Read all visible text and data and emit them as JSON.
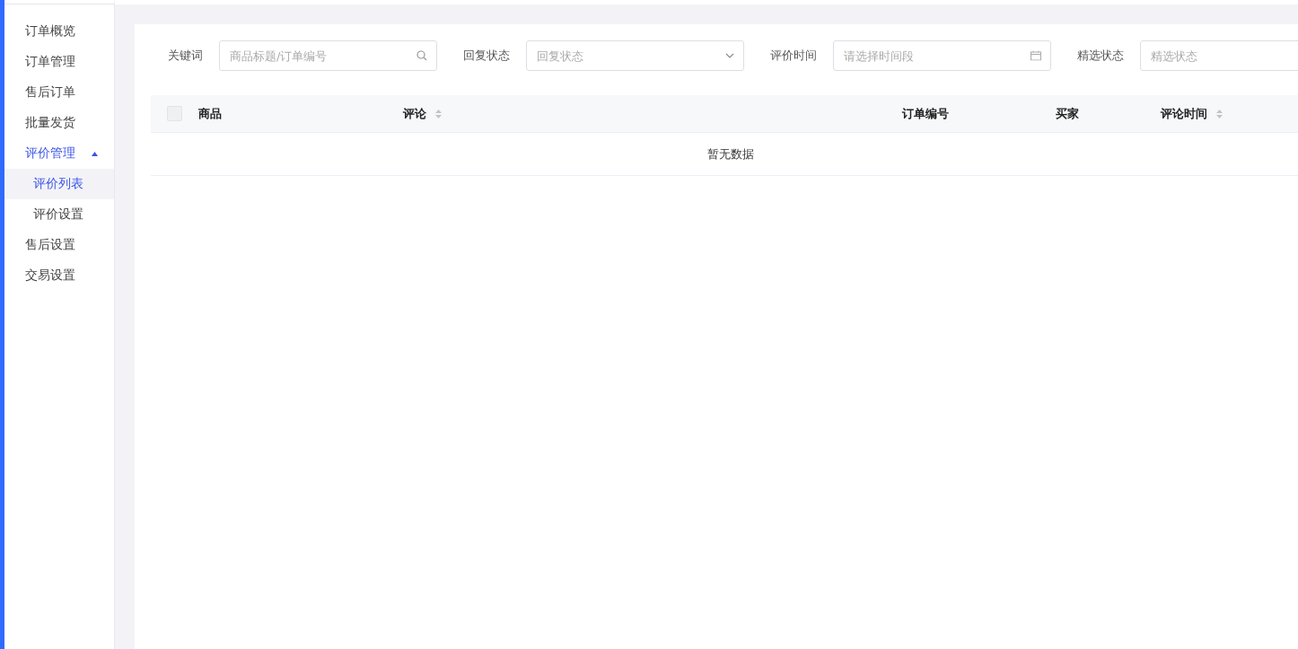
{
  "sidebar": {
    "items": [
      {
        "label": "订单概览",
        "selected": false
      },
      {
        "label": "订单管理",
        "selected": false
      },
      {
        "label": "售后订单",
        "selected": false
      },
      {
        "label": "批量发货",
        "selected": false
      },
      {
        "label": "评价管理",
        "selected": false,
        "expanded": true,
        "children": [
          {
            "label": "评价列表",
            "selected": true
          },
          {
            "label": "评价设置",
            "selected": false
          }
        ]
      },
      {
        "label": "售后设置",
        "selected": false
      },
      {
        "label": "交易设置",
        "selected": false
      }
    ]
  },
  "filters": [
    {
      "kind": "search",
      "label": "关键词",
      "placeholder": "商品标题/订单编号"
    },
    {
      "kind": "select",
      "label": "回复状态",
      "placeholder": "回复状态"
    },
    {
      "kind": "date",
      "label": "评价时间",
      "placeholder": "请选择时间段"
    },
    {
      "kind": "plain",
      "label": "精选状态",
      "placeholder": "精选状态"
    }
  ],
  "table": {
    "select_all": {
      "checked": false
    },
    "columns": [
      {
        "label": "商品",
        "sortable": false
      },
      {
        "label": "评论",
        "sortable": true
      },
      {
        "label": "订单编号",
        "sortable": false
      },
      {
        "label": "买家",
        "sortable": false
      },
      {
        "label": "评论时间",
        "sortable": true
      }
    ],
    "empty_text": "暂无数据"
  }
}
